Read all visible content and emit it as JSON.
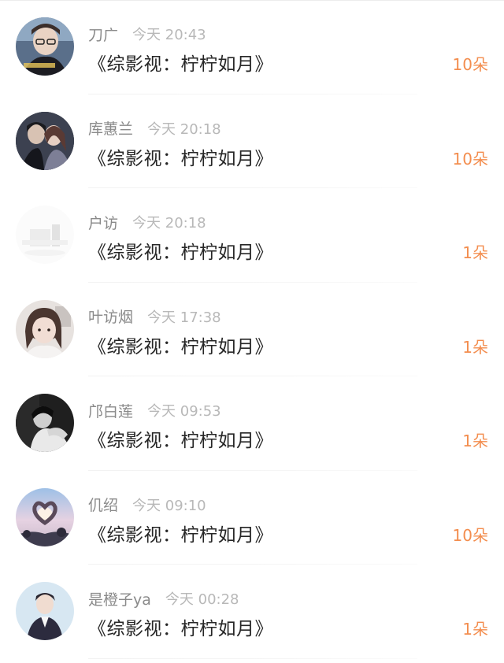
{
  "title_text": "《综影视：柠柠如月》",
  "rows": [
    {
      "name": "刀广",
      "time": "今天 20:43",
      "count": "10朵",
      "avatar": "avatar-boy-glasses"
    },
    {
      "name": "库蕙兰",
      "time": "今天 20:18",
      "count": "10朵",
      "avatar": "avatar-couple"
    },
    {
      "name": "户访",
      "time": "今天 20:18",
      "count": "1朵",
      "avatar": "avatar-faded-room"
    },
    {
      "name": "叶访烟",
      "time": "今天 17:38",
      "count": "1朵",
      "avatar": "avatar-girl-portrait"
    },
    {
      "name": "邝白莲",
      "time": "今天 09:53",
      "count": "1朵",
      "avatar": "avatar-bw-man"
    },
    {
      "name": "仉绍",
      "time": "今天 09:10",
      "count": "10朵",
      "avatar": "avatar-heart-hands"
    },
    {
      "name": "是橙子ya",
      "time": "今天 00:28",
      "count": "1朵",
      "avatar": "avatar-suit-man"
    }
  ],
  "colors": {
    "name": "#8a8a8a",
    "time": "#b8b8b8",
    "title": "#262626",
    "count": "#f38d4e"
  }
}
